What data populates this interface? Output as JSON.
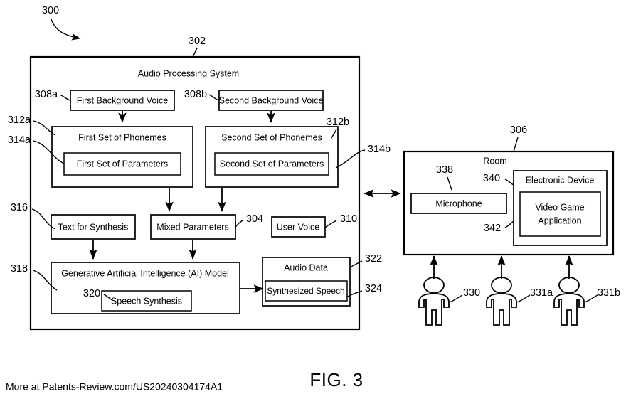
{
  "figure": {
    "caption": "FIG. 3",
    "watermark": "More at Patents-Review.com/US20240304174A1",
    "root_ref": "300"
  },
  "audio_processing_system": {
    "ref": "302",
    "title": "Audio Processing System",
    "blocks": {
      "first_background_voice": {
        "ref": "308a",
        "label": "First Background Voice"
      },
      "second_background_voice": {
        "ref": "308b",
        "label": "Second Background Voice"
      },
      "first_set_of_phonemes": {
        "ref": "312a",
        "label": "First Set of Phonemes"
      },
      "first_set_of_parameters": {
        "ref": "314a",
        "label": "First Set of Parameters"
      },
      "second_set_of_phonemes": {
        "ref": "312b",
        "label": "Second Set of Phonemes"
      },
      "second_set_of_parameters": {
        "ref": "314b",
        "label": "Second Set of Parameters"
      },
      "text_for_synthesis": {
        "ref": "316",
        "label": "Text for Synthesis"
      },
      "mixed_parameters": {
        "ref": "304",
        "label": "Mixed Parameters"
      },
      "user_voice": {
        "ref": "310",
        "label": "User Voice"
      },
      "ai_model": {
        "ref": "318",
        "label": "Generative Artificial Intelligence (AI) Model"
      },
      "speech_synthesis": {
        "ref": "320",
        "label": "Speech Synthesis"
      },
      "audio_data": {
        "ref": "322",
        "label": "Audio Data"
      },
      "synthesized_speech": {
        "ref": "324",
        "label": "Synthesized Speech"
      }
    }
  },
  "room": {
    "ref": "306",
    "title": "Room",
    "blocks": {
      "microphone": {
        "ref": "338",
        "label": "Microphone"
      },
      "electronic_device": {
        "ref": "340",
        "label": "Electronic Device"
      },
      "video_game_application": {
        "ref": "342",
        "label_line1": "Video Game",
        "label_line2": "Application"
      }
    },
    "people": [
      {
        "ref": "330"
      },
      {
        "ref": "331a"
      },
      {
        "ref": "331b"
      }
    ]
  },
  "colors": {
    "line": "#000000",
    "background": "#ffffff"
  }
}
